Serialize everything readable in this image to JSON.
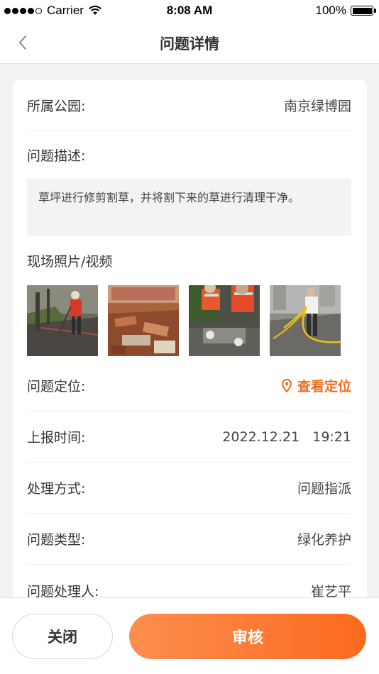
{
  "status_bar": {
    "carrier": "Carrier",
    "time": "8:08 AM",
    "battery": "100%"
  },
  "nav": {
    "title": "问题详情",
    "back_icon": "chevron-left-icon"
  },
  "detail": {
    "park": {
      "label": "所属公园:",
      "value": "南京绿博园"
    },
    "description": {
      "label": "问题描述:",
      "text": "草坪进行修剪割草，并将割下来的草进行清理干净。"
    },
    "media": {
      "label": "现场照片/视频",
      "count": 4
    },
    "location": {
      "label": "问题定位:",
      "link": "查看定位",
      "icon": "location-pin-icon"
    },
    "report_time": {
      "label": "上报时间:",
      "value": "2022.12.21   19:21"
    },
    "handling": {
      "label": "处理方式:",
      "value": "问题指派"
    },
    "type": {
      "label": "问题类型:",
      "value": "绿化养护"
    },
    "handler": {
      "label": "问题处理人:",
      "value": "崔艺平"
    }
  },
  "actions": {
    "close_label": "关闭",
    "review_label": "审核"
  },
  "colors": {
    "accent": "#f26b1d",
    "button_gradient_start": "#fd8f4f",
    "button_gradient_end": "#fc6a1e",
    "page_background": "#f2f2f2"
  }
}
